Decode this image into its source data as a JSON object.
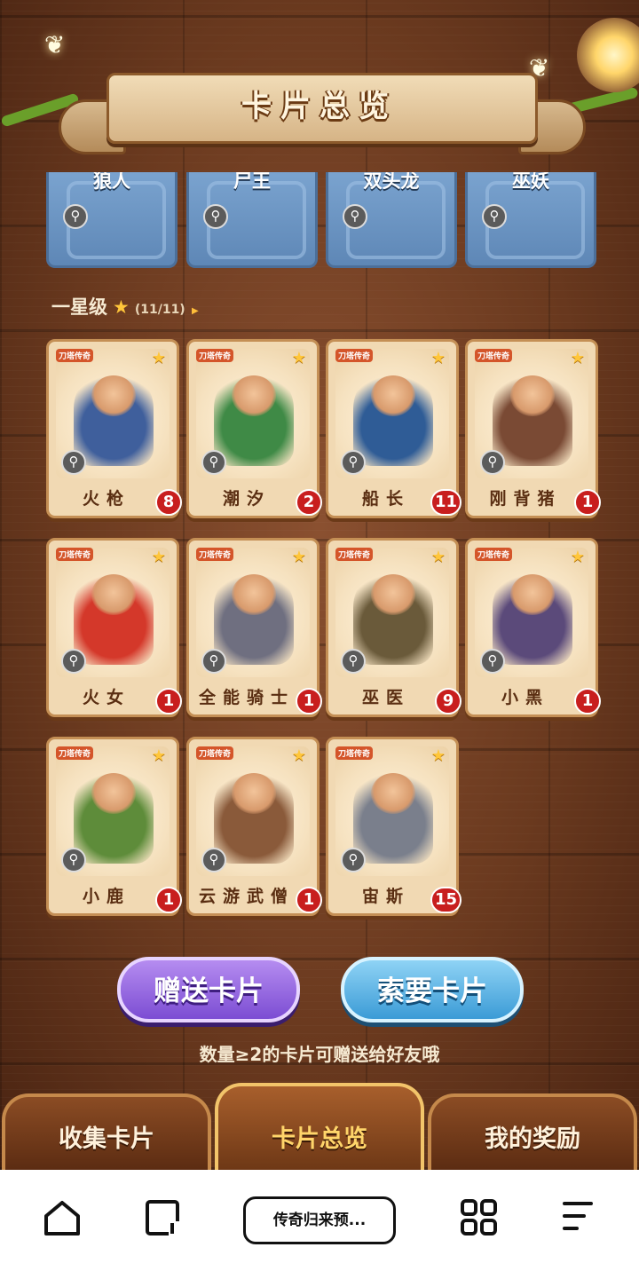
{
  "header": {
    "title": "卡片总览"
  },
  "top_row": [
    {
      "name": "狼人"
    },
    {
      "name": "尸王"
    },
    {
      "name": "双头龙"
    },
    {
      "name": "巫妖"
    }
  ],
  "section": {
    "title": "一星级",
    "count": "(11/11)"
  },
  "cards": [
    {
      "name": "火枪",
      "count": "8",
      "color": "#3f5f9c"
    },
    {
      "name": "潮汐",
      "count": "2",
      "color": "#3f8a46"
    },
    {
      "name": "船长",
      "count": "11",
      "color": "#2f5c96"
    },
    {
      "name": "刚背猪",
      "count": "1",
      "color": "#7a4a34"
    },
    {
      "name": "火女",
      "count": "1",
      "color": "#d4382a"
    },
    {
      "name": "全能骑士",
      "count": "1",
      "color": "#6f6f80"
    },
    {
      "name": "巫医",
      "count": "9",
      "color": "#6a5a3a"
    },
    {
      "name": "小黑",
      "count": "1",
      "color": "#5b4a7a"
    },
    {
      "name": "小鹿",
      "count": "1",
      "color": "#5e8c3a"
    },
    {
      "name": "云游武僧",
      "count": "1",
      "color": "#8a5a3a"
    },
    {
      "name": "宙斯",
      "count": "15",
      "color": "#7a7f8c"
    }
  ],
  "actions": {
    "gift_label": "赠送卡片",
    "ask_label": "索要卡片"
  },
  "hint": "数量≥2的卡片可赠送给好友哦",
  "tabs": [
    {
      "label": "收集卡片"
    },
    {
      "label": "卡片总览"
    },
    {
      "label": "我的奖励"
    }
  ],
  "browser": {
    "tab_title": "传奇归来预..."
  },
  "card_logo": "刀塔传奇",
  "icons": {
    "home": "home-icon",
    "tabs": "tabs-icon",
    "apps": "apps-grid-icon",
    "menu": "menu-icon",
    "magnify": "magnify-icon",
    "star": "star-icon"
  }
}
